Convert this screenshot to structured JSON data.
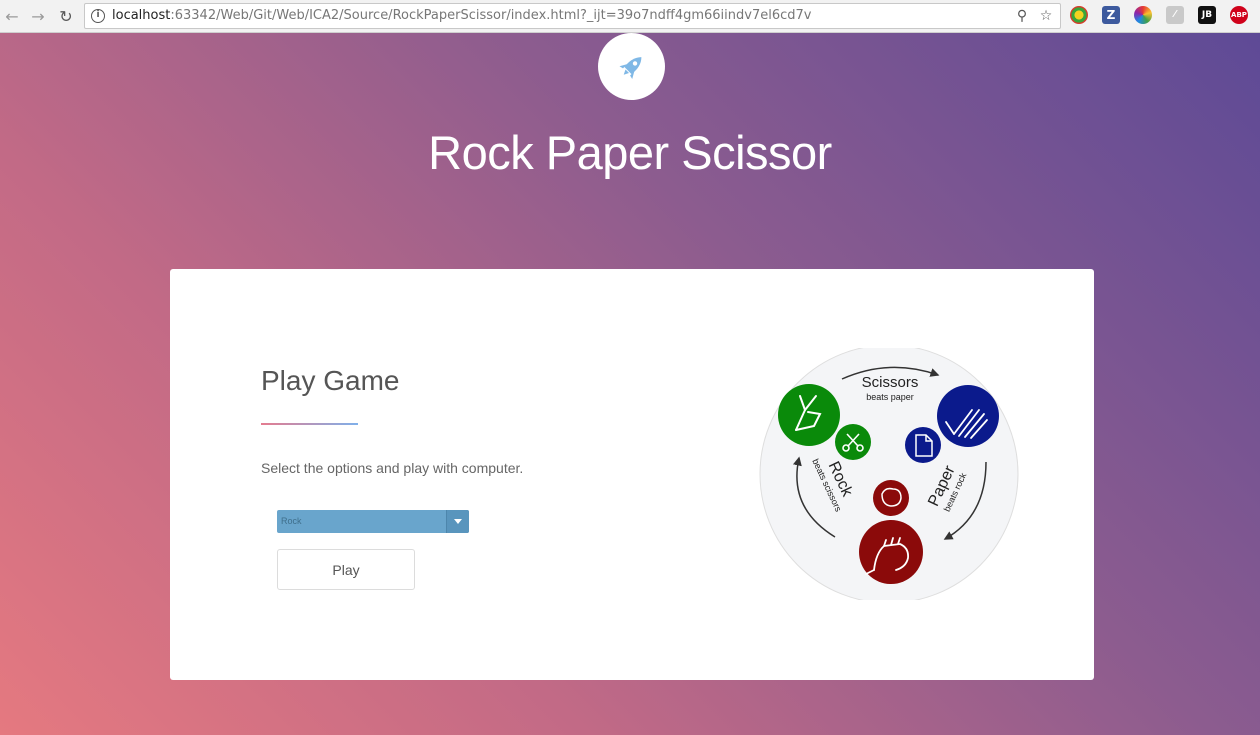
{
  "browser": {
    "url_host": "localhost",
    "url_rest": ":63342/Web/Git/Web/ICA2/Source/RockPaperScissor/index.html?_ijt=39o7ndff4gm66iindv7el6cd7v",
    "extensions": [
      "Z",
      "JB",
      "ABP"
    ]
  },
  "page": {
    "title": "Rock Paper Scissor"
  },
  "card": {
    "title": "Play Game",
    "description": "Select the options and play with computer.",
    "select_value": "Rock",
    "play_label": "Play"
  },
  "diagram": {
    "scissors_title": "Scissors",
    "scissors_sub": "beats paper",
    "rock_title": "Rock",
    "rock_sub": "beats scissors",
    "paper_title": "Paper",
    "paper_sub": "beats rock"
  },
  "colors": {
    "scissors": "#0a8a0a",
    "paper": "#0b1a8c",
    "rock": "#8b0a0a",
    "select": "#69a5cc"
  }
}
